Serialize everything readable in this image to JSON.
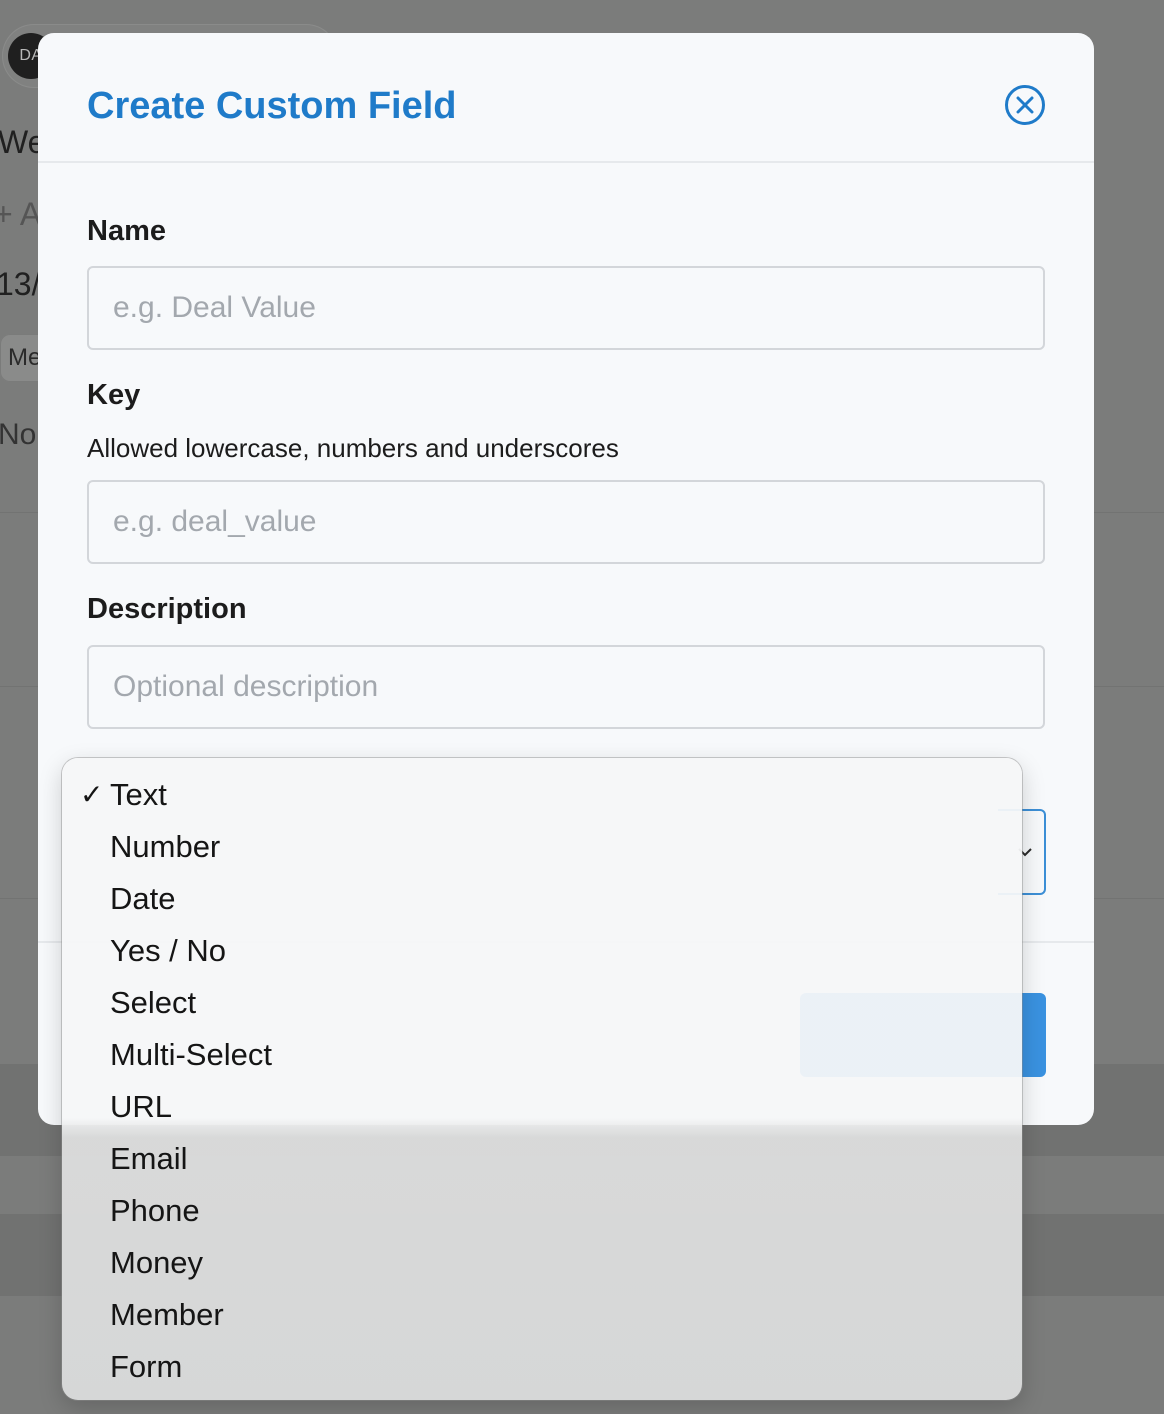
{
  "background": {
    "avatar_initials": "DA",
    "fragments": [
      "We",
      "+ A",
      "13/",
      "Me",
      "No"
    ]
  },
  "modal": {
    "title": "Create Custom Field",
    "close_icon": "close-circle-icon",
    "fields": {
      "name": {
        "label": "Name",
        "placeholder": "e.g. Deal Value",
        "value": ""
      },
      "key": {
        "label": "Key",
        "help": "Allowed lowercase, numbers and underscores",
        "placeholder": "e.g. deal_value",
        "value": ""
      },
      "description": {
        "label": "Description",
        "placeholder": "Optional description",
        "value": ""
      }
    },
    "type_select": {
      "selected": "Text",
      "chevron_icon": "chevron-down-icon"
    },
    "footer": {
      "cancel_label": "",
      "create_label": ""
    }
  },
  "dropdown": {
    "check_glyph": "✓",
    "items": [
      {
        "label": "Text",
        "selected": true
      },
      {
        "label": "Number",
        "selected": false
      },
      {
        "label": "Date",
        "selected": false
      },
      {
        "label": "Yes / No",
        "selected": false
      },
      {
        "label": "Select",
        "selected": false
      },
      {
        "label": "Multi-Select",
        "selected": false
      },
      {
        "label": "URL",
        "selected": false
      },
      {
        "label": "Email",
        "selected": false
      },
      {
        "label": "Phone",
        "selected": false
      },
      {
        "label": "Money",
        "selected": false
      },
      {
        "label": "Member",
        "selected": false
      },
      {
        "label": "Form",
        "selected": false
      }
    ]
  },
  "colors": {
    "accent": "#1f7bc9",
    "primary_button": "#3a92e0",
    "overlay": "#7b7c7b"
  }
}
